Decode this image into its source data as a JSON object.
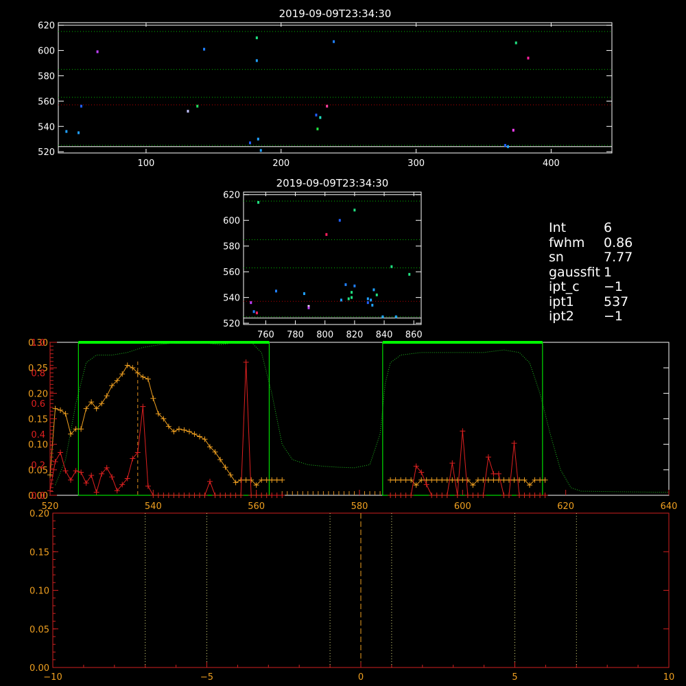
{
  "chart_data": [
    {
      "type": "scatter",
      "title": "2019-09-09T23:34:30",
      "xlim": [
        35,
        445
      ],
      "ylim": [
        519,
        622
      ],
      "xticks": [
        100,
        200,
        300,
        400
      ],
      "yticks": [
        520,
        540,
        560,
        580,
        600,
        620
      ],
      "hlines": [
        {
          "y": 615,
          "style": "dotted",
          "color": "#00c000"
        },
        {
          "y": 585,
          "style": "dotted",
          "color": "#00c000"
        },
        {
          "y": 563,
          "style": "dotted",
          "color": "#00c000"
        },
        {
          "y": 557,
          "style": "dotted",
          "color": "#c00000"
        },
        {
          "y": 525,
          "style": "dotted",
          "color": "#00c000"
        },
        {
          "y": 620,
          "style": "solid",
          "color": "#ffffff"
        },
        {
          "y": 524,
          "style": "solid",
          "color": "#ffffff"
        }
      ],
      "points": [
        {
          "x": 64,
          "y": 599,
          "c": "#c040ff"
        },
        {
          "x": 143,
          "y": 601,
          "c": "#2080ff"
        },
        {
          "x": 182,
          "y": 610,
          "c": "#20e080"
        },
        {
          "x": 182,
          "y": 592,
          "c": "#20a0ff"
        },
        {
          "x": 239,
          "y": 607,
          "c": "#2080ff"
        },
        {
          "x": 374,
          "y": 606,
          "c": "#20e080"
        },
        {
          "x": 383,
          "y": 594,
          "c": "#ff20a0"
        },
        {
          "x": 52,
          "y": 556,
          "c": "#2060ff"
        },
        {
          "x": 131,
          "y": 552,
          "c": "#c0c0ff"
        },
        {
          "x": 138,
          "y": 556,
          "c": "#20e060"
        },
        {
          "x": 226,
          "y": 549,
          "c": "#2060ff"
        },
        {
          "x": 234,
          "y": 556,
          "c": "#ff40a0"
        },
        {
          "x": 229,
          "y": 547,
          "c": "#20e0c0"
        },
        {
          "x": 41,
          "y": 536,
          "c": "#20a0ff"
        },
        {
          "x": 50,
          "y": 535,
          "c": "#20a0ff"
        },
        {
          "x": 227,
          "y": 538,
          "c": "#20e040"
        },
        {
          "x": 372,
          "y": 537,
          "c": "#ff40ff"
        },
        {
          "x": 177,
          "y": 527,
          "c": "#2060ff"
        },
        {
          "x": 183,
          "y": 530,
          "c": "#20a0ff"
        },
        {
          "x": 185,
          "y": 521,
          "c": "#20a0ff"
        },
        {
          "x": 366,
          "y": 525,
          "c": "#2060ff"
        },
        {
          "x": 368,
          "y": 524,
          "c": "#20a0ff"
        }
      ]
    },
    {
      "type": "scatter",
      "title": "2019-09-09T23:34:30",
      "xlim": [
        745,
        865
      ],
      "ylim": [
        519,
        622
      ],
      "xticks": [
        760,
        780,
        800,
        820,
        840,
        860
      ],
      "yticks": [
        520,
        540,
        560,
        580,
        600,
        620
      ],
      "hlines": [
        {
          "y": 615,
          "style": "dotted",
          "color": "#00c000"
        },
        {
          "y": 585,
          "style": "dotted",
          "color": "#00c000"
        },
        {
          "y": 563,
          "style": "dotted",
          "color": "#00c000"
        },
        {
          "y": 537,
          "style": "dotted",
          "color": "#c00000"
        },
        {
          "y": 525,
          "style": "dotted",
          "color": "#00c000"
        },
        {
          "y": 620,
          "style": "solid",
          "color": "#ffffff"
        },
        {
          "y": 524,
          "style": "solid",
          "color": "#ffffff"
        }
      ],
      "points": [
        {
          "x": 755,
          "y": 614,
          "c": "#20e080"
        },
        {
          "x": 820,
          "y": 608,
          "c": "#20e080"
        },
        {
          "x": 810,
          "y": 600,
          "c": "#2060ff"
        },
        {
          "x": 801,
          "y": 589,
          "c": "#ff2060"
        },
        {
          "x": 845,
          "y": 564,
          "c": "#20e080"
        },
        {
          "x": 857,
          "y": 558,
          "c": "#20e080"
        },
        {
          "x": 814,
          "y": 550,
          "c": "#2080ff"
        },
        {
          "x": 820,
          "y": 549,
          "c": "#2080ff"
        },
        {
          "x": 833,
          "y": 546,
          "c": "#20a0ff"
        },
        {
          "x": 767,
          "y": 545,
          "c": "#2080ff"
        },
        {
          "x": 786,
          "y": 543,
          "c": "#20a0ff"
        },
        {
          "x": 818,
          "y": 544,
          "c": "#20e080"
        },
        {
          "x": 835,
          "y": 542,
          "c": "#20e080"
        },
        {
          "x": 811,
          "y": 538,
          "c": "#20a0ff"
        },
        {
          "x": 816,
          "y": 539,
          "c": "#20e080"
        },
        {
          "x": 818,
          "y": 540,
          "c": "#20e080"
        },
        {
          "x": 829,
          "y": 539,
          "c": "#20a0ff"
        },
        {
          "x": 831,
          "y": 538,
          "c": "#20a0ff"
        },
        {
          "x": 832,
          "y": 534,
          "c": "#20a0ff"
        },
        {
          "x": 829,
          "y": 536,
          "c": "#2060ff"
        },
        {
          "x": 750,
          "y": 536,
          "c": "#c040ff"
        },
        {
          "x": 789,
          "y": 533,
          "c": "#ffffff"
        },
        {
          "x": 789,
          "y": 532,
          "c": "#c040ff"
        },
        {
          "x": 752,
          "y": 529,
          "c": "#2080ff"
        },
        {
          "x": 754,
          "y": 528,
          "c": "#ff2060"
        },
        {
          "x": 839,
          "y": 525,
          "c": "#20a0ff"
        },
        {
          "x": 848,
          "y": 525,
          "c": "#20a0ff"
        }
      ]
    },
    {
      "type": "line",
      "xlim": [
        520,
        640
      ],
      "ylim": [
        0,
        0.3
      ],
      "xticks": [
        520,
        540,
        560,
        580,
        600,
        620,
        640
      ],
      "yticks_left": [
        "0.00",
        "0.05",
        "0.10",
        "0.15",
        "0.20",
        "0.25",
        "0.30"
      ],
      "yticks_left_values": [
        0,
        0.05,
        0.1,
        0.15,
        0.2,
        0.25,
        0.3
      ],
      "yticks_red": [
        "0.0",
        "0.2",
        "0.4",
        "0.6",
        "0.8",
        "1.0"
      ],
      "yticks_red_values": [
        0,
        0.2,
        0.4,
        0.6,
        0.8,
        1.0
      ],
      "green_boxes": [
        [
          525.5,
          562.5
        ],
        [
          584.5,
          615.5
        ]
      ],
      "dashed_vline": 537,
      "green_profile": [
        [
          521,
          0.02
        ],
        [
          523,
          0.07
        ],
        [
          525,
          0.18
        ],
        [
          527,
          0.26
        ],
        [
          529,
          0.275
        ],
        [
          532,
          0.275
        ],
        [
          535,
          0.28
        ],
        [
          538,
          0.29
        ],
        [
          541,
          0.295
        ],
        [
          545,
          0.3
        ],
        [
          549,
          0.3
        ],
        [
          553,
          0.295
        ],
        [
          556,
          0.3
        ],
        [
          559,
          0.3
        ],
        [
          561,
          0.28
        ],
        [
          563,
          0.2
        ],
        [
          565,
          0.1
        ],
        [
          567,
          0.07
        ],
        [
          570,
          0.06
        ],
        [
          573,
          0.057
        ],
        [
          576,
          0.055
        ],
        [
          579,
          0.054
        ],
        [
          582,
          0.06
        ],
        [
          584,
          0.12
        ],
        [
          585,
          0.22
        ],
        [
          586,
          0.26
        ],
        [
          588,
          0.275
        ],
        [
          592,
          0.28
        ],
        [
          596,
          0.28
        ],
        [
          600,
          0.28
        ],
        [
          604,
          0.28
        ],
        [
          608,
          0.285
        ],
        [
          611,
          0.28
        ],
        [
          613,
          0.26
        ],
        [
          615,
          0.2
        ],
        [
          617,
          0.12
        ],
        [
          619,
          0.05
        ],
        [
          621,
          0.015
        ],
        [
          623,
          0.008
        ],
        [
          630,
          0.007
        ],
        [
          638,
          0.006
        ],
        [
          640,
          0.006
        ]
      ],
      "orange_series": [
        [
          520,
          0.04
        ],
        [
          521,
          0.17
        ],
        [
          522,
          0.167
        ],
        [
          523,
          0.16
        ],
        [
          524,
          0.12
        ],
        [
          525,
          0.13
        ],
        [
          526,
          0.13
        ],
        [
          527,
          0.17
        ],
        [
          528,
          0.183
        ],
        [
          529,
          0.17
        ],
        [
          530,
          0.18
        ],
        [
          531,
          0.195
        ],
        [
          532,
          0.215
        ],
        [
          533,
          0.225
        ],
        [
          534,
          0.238
        ],
        [
          535,
          0.255
        ],
        [
          536,
          0.25
        ],
        [
          537,
          0.24
        ],
        [
          538,
          0.232
        ],
        [
          539,
          0.228
        ],
        [
          540,
          0.19
        ],
        [
          541,
          0.16
        ],
        [
          542,
          0.15
        ],
        [
          543,
          0.135
        ],
        [
          544,
          0.125
        ],
        [
          545,
          0.13
        ],
        [
          546,
          0.128
        ],
        [
          547,
          0.125
        ],
        [
          548,
          0.12
        ],
        [
          549,
          0.115
        ],
        [
          550,
          0.11
        ],
        [
          551,
          0.095
        ],
        [
          552,
          0.085
        ],
        [
          553,
          0.07
        ],
        [
          554,
          0.055
        ],
        [
          555,
          0.04
        ],
        [
          556,
          0.025
        ],
        [
          557,
          0.03
        ],
        [
          558,
          0.03
        ],
        [
          559,
          0.03
        ],
        [
          560,
          0.02
        ],
        [
          561,
          0.03
        ],
        [
          562,
          0.03
        ],
        [
          563,
          0.03
        ],
        [
          564,
          0.03
        ],
        [
          565,
          0.03
        ],
        [
          586,
          0.03
        ],
        [
          587,
          0.03
        ],
        [
          588,
          0.03
        ],
        [
          589,
          0.03
        ],
        [
          590,
          0.03
        ],
        [
          591,
          0.02
        ],
        [
          592,
          0.03
        ],
        [
          593,
          0.03
        ],
        [
          594,
          0.03
        ],
        [
          595,
          0.03
        ],
        [
          596,
          0.03
        ],
        [
          597,
          0.03
        ],
        [
          598,
          0.03
        ],
        [
          599,
          0.03
        ],
        [
          600,
          0.03
        ],
        [
          601,
          0.03
        ],
        [
          602,
          0.02
        ],
        [
          603,
          0.03
        ],
        [
          604,
          0.03
        ],
        [
          605,
          0.03
        ],
        [
          606,
          0.03
        ],
        [
          607,
          0.03
        ],
        [
          608,
          0.03
        ],
        [
          609,
          0.03
        ],
        [
          610,
          0.03
        ],
        [
          611,
          0.03
        ],
        [
          612,
          0.03
        ],
        [
          613,
          0.02
        ],
        [
          614,
          0.03
        ],
        [
          615,
          0.03
        ],
        [
          616,
          0.03
        ]
      ],
      "red_series": [
        [
          520,
          0.03
        ],
        [
          521,
          0.22
        ],
        [
          522,
          0.28
        ],
        [
          523,
          0.16
        ],
        [
          524,
          0.1
        ],
        [
          525,
          0.16
        ],
        [
          526,
          0.15
        ],
        [
          527,
          0.08
        ],
        [
          528,
          0.13
        ],
        [
          529,
          0.02
        ],
        [
          530,
          0.14
        ],
        [
          531,
          0.18
        ],
        [
          532,
          0.12
        ],
        [
          533,
          0.03
        ],
        [
          534,
          0.07
        ],
        [
          535,
          0.11
        ],
        [
          536,
          0.24
        ],
        [
          537,
          0.28
        ],
        [
          538,
          0.58
        ],
        [
          539,
          0.06
        ],
        [
          540,
          0.0
        ],
        [
          541,
          0.0
        ],
        [
          542,
          0.0
        ],
        [
          543,
          0.0
        ],
        [
          544,
          0.0
        ],
        [
          545,
          0.0
        ],
        [
          546,
          0.0
        ],
        [
          547,
          0.0
        ],
        [
          548,
          0.0
        ],
        [
          549,
          0.0
        ],
        [
          550,
          0.0
        ],
        [
          551,
          0.09
        ],
        [
          552,
          0.0
        ],
        [
          553,
          0.0
        ],
        [
          554,
          0.0
        ],
        [
          555,
          0.0
        ],
        [
          556,
          0.0
        ],
        [
          557,
          0.0
        ],
        [
          558,
          0.87
        ],
        [
          559,
          0.0
        ],
        [
          560,
          0.0
        ],
        [
          561,
          0.0
        ],
        [
          562,
          0.0
        ],
        [
          563,
          0.0
        ],
        [
          564,
          0.0
        ],
        [
          565,
          0.0
        ],
        [
          586,
          0.0
        ],
        [
          587,
          0.0
        ],
        [
          588,
          0.0
        ],
        [
          589,
          0.0
        ],
        [
          590,
          0.0
        ],
        [
          591,
          0.19
        ],
        [
          592,
          0.15
        ],
        [
          593,
          0.07
        ],
        [
          594,
          0.0
        ],
        [
          595,
          0.0
        ],
        [
          596,
          0.0
        ],
        [
          597,
          0.0
        ],
        [
          598,
          0.21
        ],
        [
          599,
          0.0
        ],
        [
          600,
          0.42
        ],
        [
          601,
          0.0
        ],
        [
          602,
          0.0
        ],
        [
          603,
          0.0
        ],
        [
          604,
          0.0
        ],
        [
          605,
          0.25
        ],
        [
          606,
          0.14
        ],
        [
          607,
          0.14
        ],
        [
          608,
          0.0
        ],
        [
          609,
          0.0
        ],
        [
          610,
          0.34
        ],
        [
          611,
          0.0
        ],
        [
          612,
          0.0
        ],
        [
          613,
          0.0
        ],
        [
          614,
          0.0
        ],
        [
          615,
          0.0
        ],
        [
          616,
          0.0
        ]
      ],
      "zero_tick_range": [
        565,
        584
      ]
    },
    {
      "type": "line",
      "xlim": [
        -10,
        10
      ],
      "ylim": [
        0,
        0.2
      ],
      "xticks": [
        "-10",
        "-5",
        "0",
        "5",
        "10"
      ],
      "xtick_values": [
        -10,
        -5,
        0,
        5,
        10
      ],
      "yticks": [
        "0.00",
        "0.05",
        "0.10",
        "0.15",
        "0.20"
      ],
      "ytick_values": [
        0,
        0.05,
        0.1,
        0.15,
        0.2
      ],
      "dotted_vlines": [
        -7,
        -5,
        -1,
        1,
        5,
        7
      ],
      "dashed_vline": 0
    }
  ],
  "stats": [
    {
      "key": "Int",
      "value": "6"
    },
    {
      "key": "fwhm",
      "value": "0.86"
    },
    {
      "key": "sn",
      "value": "7.77"
    },
    {
      "key": "gaussfit",
      "value": "1"
    },
    {
      "key": "ipt_c",
      "value": "−1"
    },
    {
      "key": "ipt1",
      "value": "537"
    },
    {
      "key": "ipt2",
      "value": "−1"
    }
  ]
}
